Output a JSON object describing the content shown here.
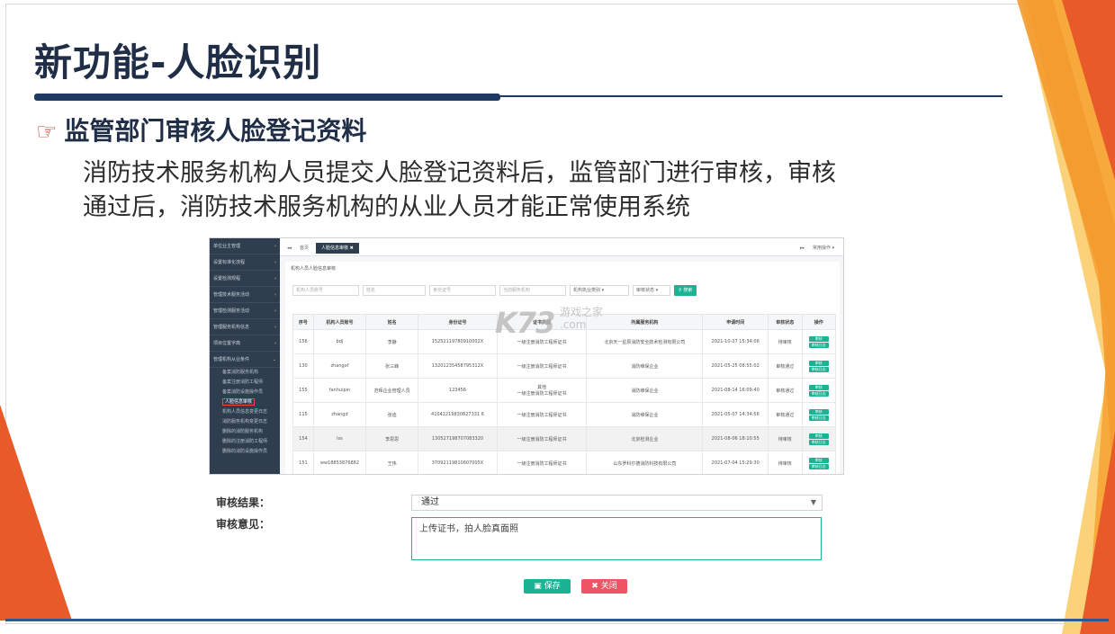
{
  "slide": {
    "title": "新功能-人脸识别",
    "bullet": "监管部门审核人脸登记资料",
    "bullet_icon": "pointing-hand-icon",
    "paragraph_line1": "消防技术服务机构人员提交人脸登记资料后，监管部门进行审核，审核",
    "paragraph_line2": "通过后，消防技术服务机构的从业人员才能正常使用系统"
  },
  "colors": {
    "accent_orange": "#e95a2a",
    "accent_yellow": "#f7a93b",
    "title_navy": "#1f2d47",
    "app_green": "#1ab394",
    "app_red": "#ed5565"
  },
  "app": {
    "sidebar": {
      "items": [
        "单位业主管理",
        "设置标准化流程",
        "设置检测规程",
        "管理技术服务活动",
        "管理检测服务活动",
        "管理服务机构信息",
        "项目位置字典",
        "管理机构从业条件"
      ],
      "sub_items": [
        "备案消防服务机构",
        "备案注册消防工程师",
        "备案消防设施操作员",
        "人脸信息审核",
        "机构人员信息变更日志",
        "消防服务机构变更日志",
        "删除的消防服务机构",
        "删除的注册消防工程师",
        "删除的消防设施操作员"
      ],
      "active_sub_index": 3
    },
    "topbar": {
      "home_tab": "首页",
      "active_tab": "人脸信息审核",
      "right_label": "常用操作"
    },
    "breadcrumb": "机构人员人脸信息审核",
    "filters": {
      "account_placeholder": "机构人员账号",
      "name_placeholder": "姓名",
      "id_placeholder": "身份证号",
      "org_placeholder": "当前服务机构",
      "type_select": "机构执业类别",
      "status_select": "审核状态",
      "search_button": "搜索"
    },
    "table": {
      "headers": [
        "序号",
        "机构人员账号",
        "姓名",
        "身份证号",
        "证书类型",
        "所属服务机构",
        "申请时间",
        "审核状态",
        "操作"
      ],
      "rows": [
        [
          "156",
          "bdj",
          "李静",
          "15252119780910002X",
          "一级注册消防工程师证书",
          "北京天一星辰消防安全技术检测有限公司",
          "2021-10-27 15:34:06",
          "待审核"
        ],
        [
          "130",
          "zhangxf",
          "张三峰",
          "13201235458795312X",
          "一级注册消防工程师证书",
          "消防维保企业",
          "2021-05-25 08:55:02",
          "审核通过"
        ],
        [
          "155",
          "fanhuipin",
          "范晖企业管理人员",
          "123456",
          "其他\n一级注册消防工程师证书",
          "消防维保企业",
          "2021-08-14 16:09:40",
          "审核通过"
        ],
        [
          "115",
          "zhangd",
          "张迪",
          "41042219830827331 6",
          "一级注册消防工程师证书",
          "消防维保企业",
          "2021-05-07 14:34:56",
          "审核通过"
        ],
        [
          "154",
          "lss",
          "李思思",
          "130527198707083320",
          "一级注册消防工程师证书",
          "北京检测企业",
          "2021-08-06 18:10:55",
          "待审核"
        ],
        [
          "151",
          "ww18853876882",
          "王伟",
          "37092119810607005X",
          "一级注册消防工程师证书",
          "山东罗科尔德消防科技有限公司",
          "2021-07-04 15:29:30",
          "待审核"
        ]
      ],
      "op_review": "审核",
      "op_log": "审核日志"
    },
    "watermark": {
      "brand": "K73",
      "text1": "游戏之家",
      "text2": ".com"
    }
  },
  "form": {
    "result_label": "审核结果：",
    "result_value": "通过",
    "opinion_label": "审核意见：",
    "opinion_value": "上传证书，拍人脸真面照",
    "save_button": "保存",
    "close_button": "关闭"
  }
}
